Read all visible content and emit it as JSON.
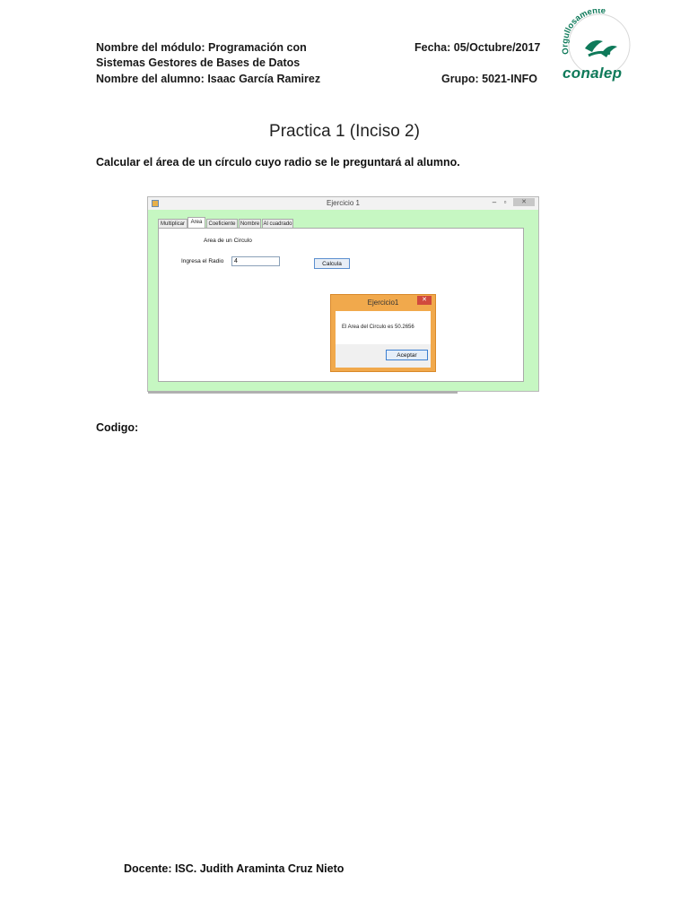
{
  "header": {
    "modulo_line1": "Nombre del módulo: Programación con",
    "modulo_line2": "Sistemas Gestores de Bases de Datos",
    "alumno": "Nombre del alumno: Isaac García Ramirez",
    "fecha": "Fecha: 05/Octubre/2017",
    "grupo": "Grupo: 5021-INFO"
  },
  "logo": {
    "arc_text": "Orgullosamente",
    "word": "conalep",
    "color": "#0f7a5a"
  },
  "title": "Practica 1 (Inciso 2)",
  "task": "Calcular el área de un círculo cuyo radio se le preguntará al alumno.",
  "window": {
    "title": "Ejercicio 1",
    "minimize": "–",
    "maximize": "▫",
    "close": "✕",
    "tabs": [
      "Multiplicar",
      "Area",
      "Coeficiente",
      "Nombre",
      "Al cuadrado"
    ],
    "active_tab": "Area",
    "heading": "Area de un Circulo",
    "radio_label": "Ingresa el Radio",
    "radio_value": "4",
    "calc_button": "Calcula",
    "bg_color": "#c6f7c2"
  },
  "msgbox": {
    "title": "Ejercicio1",
    "close": "✕",
    "message": "El Area del Circulo es 50.2656",
    "ok_button": "Aceptar",
    "accent": "#f1a94c"
  },
  "codigo_label": "Codigo:",
  "docente": "Docente: ISC. Judith Araminta Cruz Nieto"
}
